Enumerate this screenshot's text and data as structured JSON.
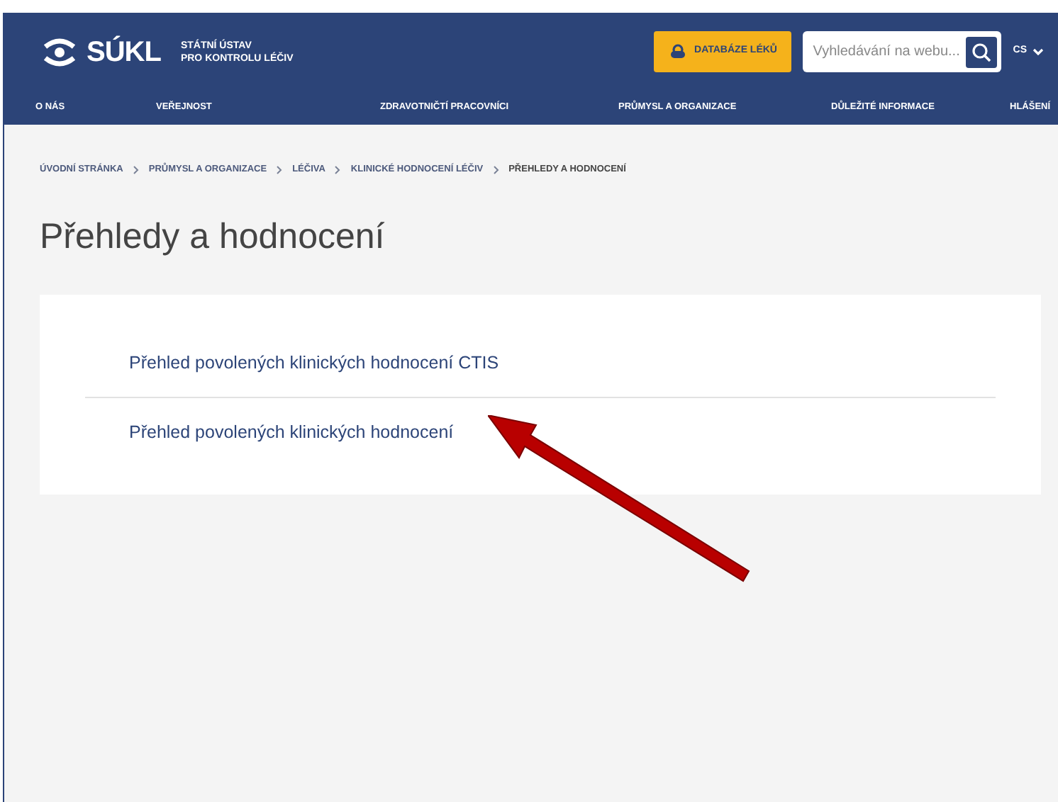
{
  "header": {
    "logo_text": "SÚKL",
    "logo_subtitle": [
      "STÁTNÍ ÚSTAV",
      "PRO KONTROLU LÉČIV"
    ],
    "database_button": "DATABÁZE LÉKŮ",
    "search": {
      "placeholder": "Vyhledávání na webu..."
    },
    "language": "CS"
  },
  "nav": [
    {
      "label": "O NÁS"
    },
    {
      "label": "VEŘEJNOST"
    },
    {
      "label": "ZDRAVOTNIČTÍ PRACOVNÍCI"
    },
    {
      "label": "PRŮMYSL A ORGANIZACE"
    },
    {
      "label": "DŮLEŽITÉ INFORMACE"
    },
    {
      "label": "HLÁŠENÍ"
    }
  ],
  "breadcrumbs": [
    {
      "label": "ÚVODNÍ STRÁNKA",
      "current": false
    },
    {
      "label": "PRŮMYSL A ORGANIZACE",
      "current": false
    },
    {
      "label": "LÉČIVA",
      "current": false
    },
    {
      "label": "KLINICKÉ HODNOCENÍ LÉČIV",
      "current": false
    },
    {
      "label": "PŘEHLEDY A HODNOCENÍ",
      "current": true
    }
  ],
  "page_title": "Přehledy a hodnocení",
  "links": [
    "Přehled povolených klinických hodnocení CTIS",
    "Přehled povolených klinických hodnocení"
  ]
}
